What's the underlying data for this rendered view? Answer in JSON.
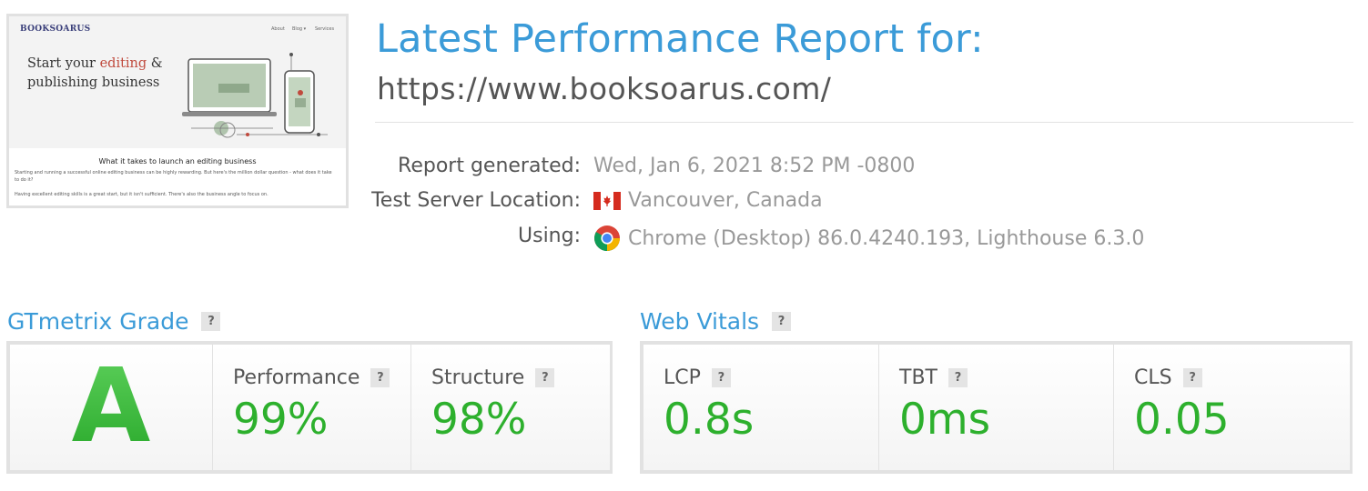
{
  "thumbnail": {
    "logo": "BOOKSOARUS",
    "nav": [
      "About",
      "Blog ▾",
      "Services"
    ],
    "headline_part1": "Start your ",
    "headline_accent": "editing",
    "headline_part2": " & publishing business",
    "section_title": "What it takes to launch an editing business",
    "para1": "Starting and running a successful online editing business can be highly rewarding. But here's the million dollar question - what does it take to do it?",
    "para2": "Having excellent editing skills is a great start, but it isn't sufficient. There's also the business angle to focus on."
  },
  "report": {
    "title": "Latest Performance Report for:",
    "url": "https://www.booksoarus.com/",
    "meta": [
      {
        "label": "Report generated:",
        "value": "Wed, Jan 6, 2021 8:52 PM -0800",
        "icon": ""
      },
      {
        "label": "Test Server Location:",
        "value": "Vancouver, Canada",
        "icon": "canada-flag-icon"
      },
      {
        "label": "Using:",
        "value": "Chrome (Desktop) 86.0.4240.193, Lighthouse 6.3.0",
        "icon": "chrome-icon"
      }
    ]
  },
  "gtmetrix": {
    "title": "GTmetrix Grade",
    "help": "?",
    "grade": "A",
    "performance_label": "Performance",
    "performance_value": "99%",
    "structure_label": "Structure",
    "structure_value": "98%"
  },
  "web_vitals": {
    "title": "Web Vitals",
    "help": "?",
    "metrics": [
      {
        "label": "LCP",
        "value": "0.8s"
      },
      {
        "label": "TBT",
        "value": "0ms"
      },
      {
        "label": "CLS",
        "value": "0.05"
      }
    ]
  },
  "colors": {
    "accent": "#3b9bd8",
    "good": "#2db02d",
    "muted": "#999999"
  }
}
